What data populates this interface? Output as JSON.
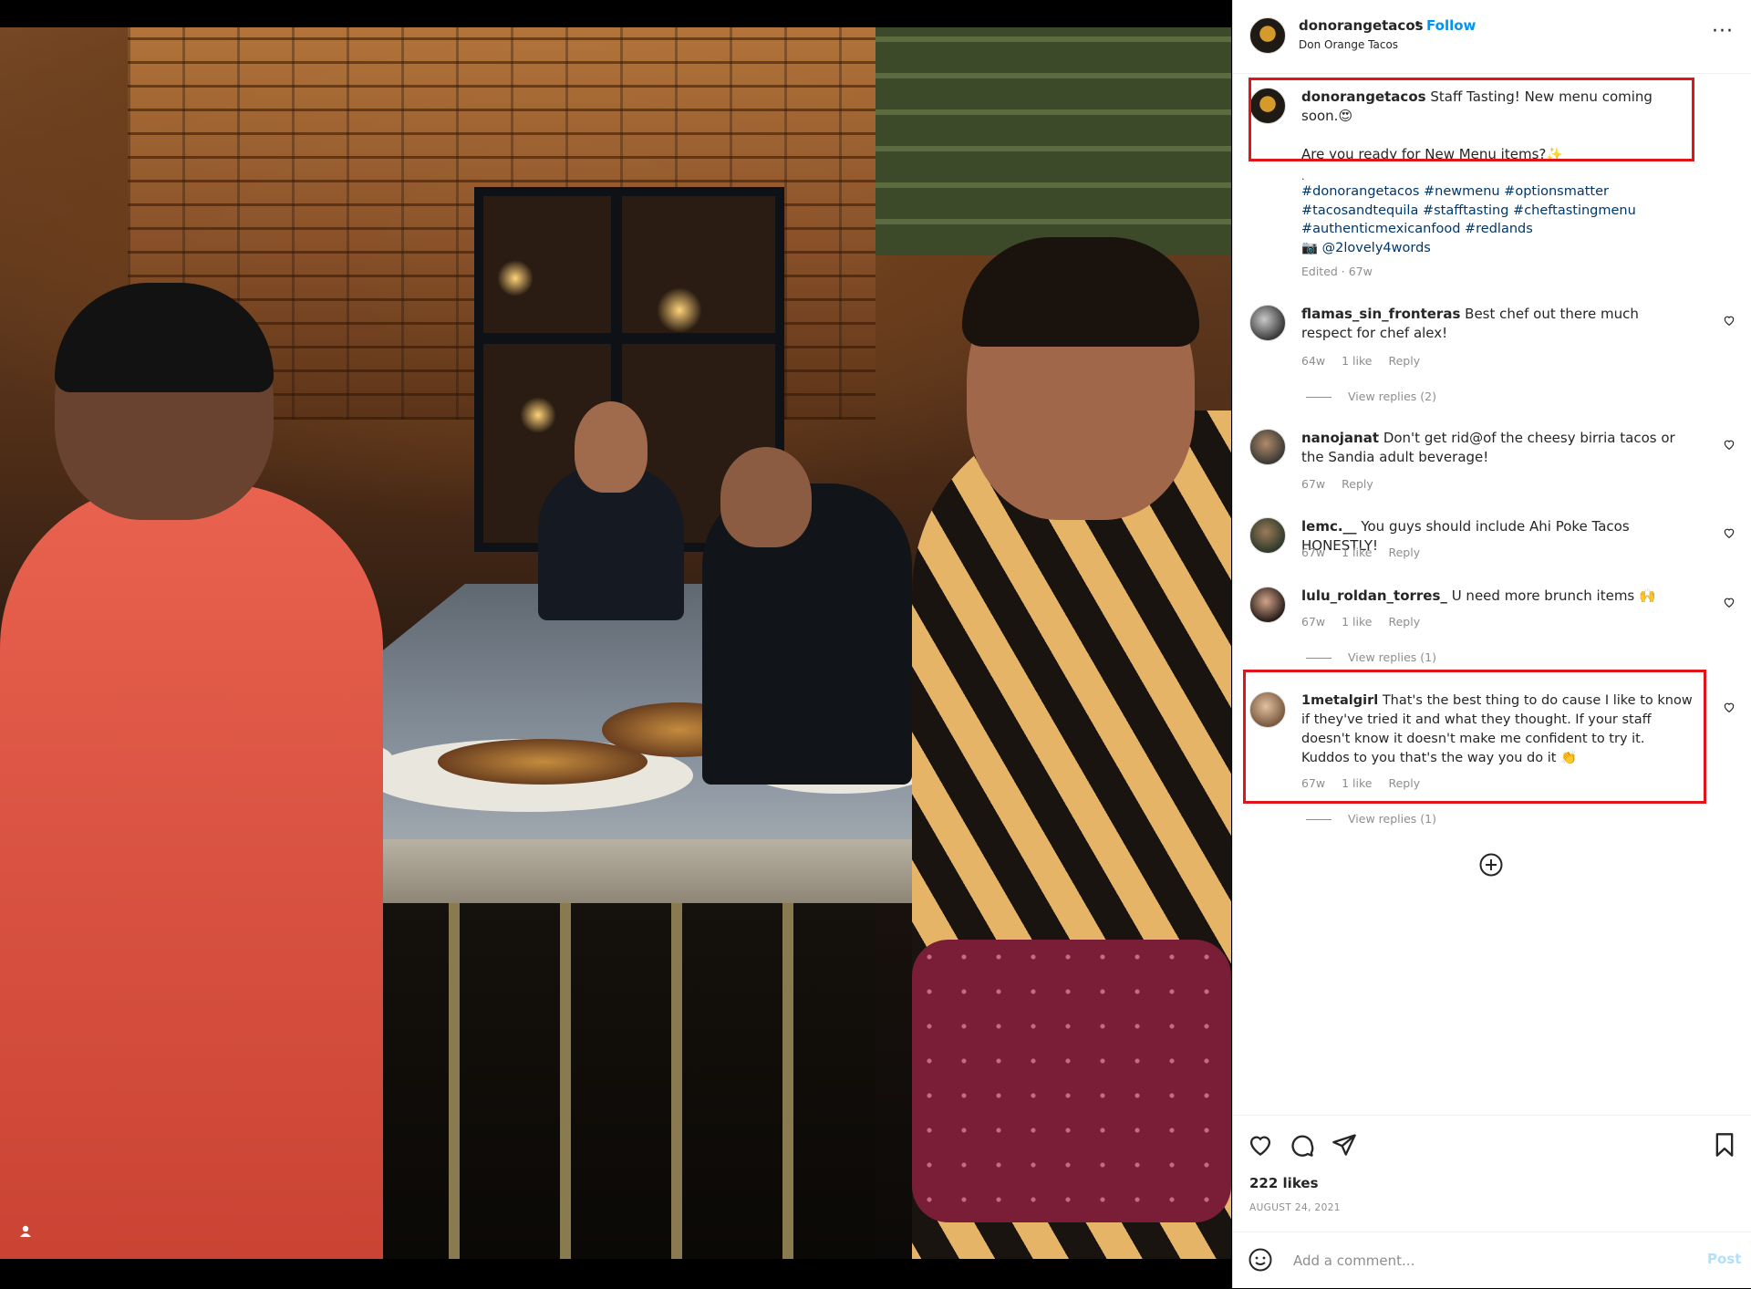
{
  "post": {
    "username": "donorangetacos",
    "follow_label": "Follow",
    "dot": "•",
    "location": "Don Orange Tacos",
    "more_label": "···"
  },
  "caption": {
    "username": "donorangetacos",
    "line1": "Staff Tasting! New menu coming soon.😍",
    "line2": "Are you ready for New Menu items?✨",
    "dots": ".",
    "hashtags": "#donorangetacos #newmenu #optionsmatter #tacosandtequila #stafftasting #cheftastingmenu #authenticmexicanfood #redlands",
    "credit": "📷 @2lovely4words",
    "edited": "Edited · 67w"
  },
  "comments": [
    {
      "user": "flamas_sin_fronteras",
      "text": "Best chef out there much respect for chef alex!",
      "age": "64w",
      "likes": "1 like",
      "reply": "Reply",
      "view_replies": "View replies (2)"
    },
    {
      "user": "nanojanat",
      "text": "Don't get rid@of the cheesy birria tacos or the Sandia adult beverage!",
      "age": "67w",
      "likes": "",
      "reply": "Reply",
      "view_replies": ""
    },
    {
      "user": "lemc.__",
      "text": "You guys should include Ahi Poke Tacos HONESTLY!",
      "age": "67w",
      "likes": "1 like",
      "reply": "Reply",
      "view_replies": ""
    },
    {
      "user": "lulu_roldan_torres_",
      "text": "U need more brunch items 🙌",
      "age": "67w",
      "likes": "1 like",
      "reply": "Reply",
      "view_replies": "View replies (1)"
    },
    {
      "user": "1metalgirl",
      "text": "That's the best thing to do cause I like to know if they've tried it and what they thought. If your staff doesn't know it doesn't make me confident to try it.",
      "text2": "Kuddos to you that's the way you do it 👏",
      "age": "67w",
      "likes": "1 like",
      "reply": "Reply",
      "view_replies": "View replies (1)"
    }
  ],
  "footer": {
    "likes": "222 likes",
    "date": "AUGUST 24, 2021",
    "add_placeholder": "Add a comment...",
    "post_label": "Post"
  },
  "icons": {
    "like": "heart-icon",
    "comment": "comment-icon",
    "share": "paper-plane-icon",
    "save": "bookmark-icon",
    "emoji": "smiley-icon",
    "load_more": "plus-circle-icon",
    "tag": "user-tag-icon"
  },
  "colors": {
    "follow": "#0095f6",
    "highlight_box": "#e1141a",
    "hashtag": "#00376b",
    "muted": "#8e8e8e"
  }
}
